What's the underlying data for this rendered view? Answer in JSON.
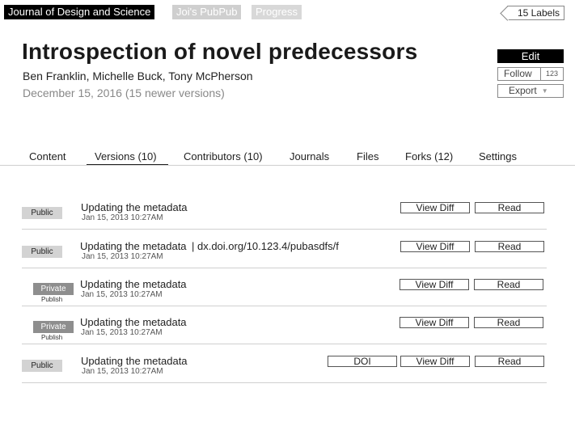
{
  "top_tags": [
    "Journal of Design and Science",
    "Joi's PubPub",
    "Progress"
  ],
  "labels_button": "15 Labels",
  "title": "Introspection of novel predecessors",
  "authors": "Ben Franklin, Michelle Buck, Tony McPherson",
  "date_line": "December 15, 2016  (15 newer versions)",
  "actions": {
    "edit": "Edit",
    "follow": "Follow",
    "follow_count": "123",
    "export": "Export",
    "export_caret": "▼"
  },
  "tabs": [
    "Content",
    "Versions  (10)",
    "Contributors (10)",
    "Journals",
    "Files",
    "Forks (12)",
    "Settings"
  ],
  "active_tab": "Versions  (10)",
  "versions": [
    {
      "badge": "Public",
      "badge_type": "public",
      "sub": "",
      "message": "Updating the metadata",
      "doi_text": "",
      "time": "Jan 15, 2013 10:27AM",
      "doi_button": "",
      "view_diff": "View Diff",
      "read": "Read"
    },
    {
      "badge": "Public",
      "badge_type": "public",
      "sub": "",
      "message": "Updating the metadata",
      "doi_text": "|  dx.doi.org/10.123.4/pubasdfs/f",
      "time": "Jan 15, 2013 10:27AM",
      "doi_button": "",
      "view_diff": "View Diff",
      "read": "Read"
    },
    {
      "badge": "Private",
      "badge_type": "private",
      "sub": "Publish",
      "message": "Updating the metadata",
      "doi_text": "",
      "time": "Jan 15, 2013 10:27AM",
      "doi_button": "",
      "view_diff": "View Diff",
      "read": "Read"
    },
    {
      "badge": "Private",
      "badge_type": "private",
      "sub": "Publish",
      "message": "Updating the metadata",
      "doi_text": "",
      "time": "Jan 15, 2013 10:27AM",
      "doi_button": "",
      "view_diff": "View Diff",
      "read": "Read"
    },
    {
      "badge": "Public",
      "badge_type": "public",
      "sub": "",
      "message": "Updating the metadata",
      "doi_text": "",
      "time": "Jan 15, 2013 10:27AM",
      "doi_button": "DOI",
      "view_diff": "View Diff",
      "read": "Read"
    }
  ]
}
